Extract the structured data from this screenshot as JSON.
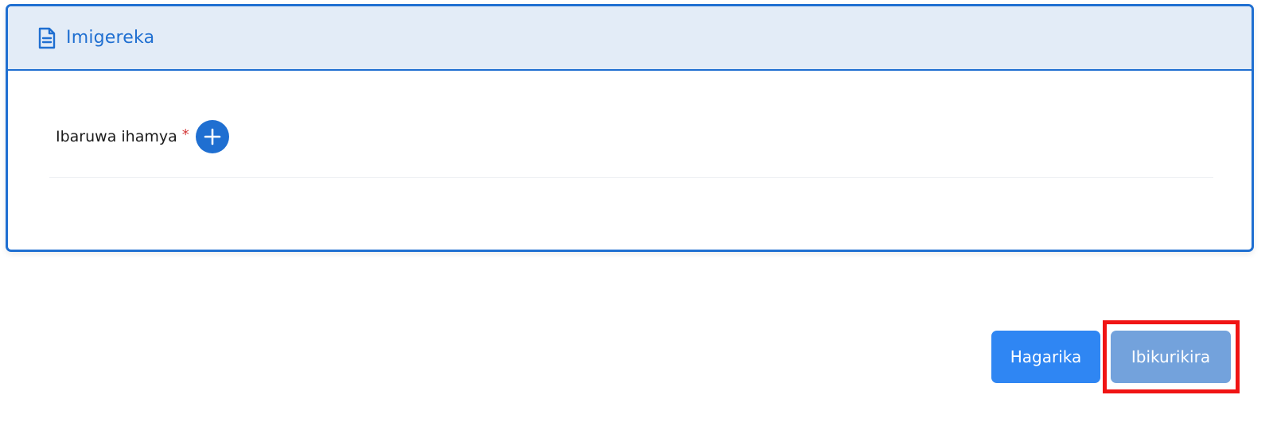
{
  "section": {
    "icon": "document-icon",
    "title": "Imigereka"
  },
  "field": {
    "label": "Ibaruwa ihamya",
    "required_mark": "*",
    "add_icon": "plus-circle-icon"
  },
  "actions": {
    "cancel_label": "Hagarika",
    "next_label": "Ibikurikira"
  },
  "colors": {
    "accent": "#1f6fd1",
    "header_bg": "#e3ecf7",
    "cancel_button": "#2f86f3",
    "next_button_disabled": "#73a2dc",
    "highlight": "#f01414",
    "required": "#d33a3a"
  }
}
